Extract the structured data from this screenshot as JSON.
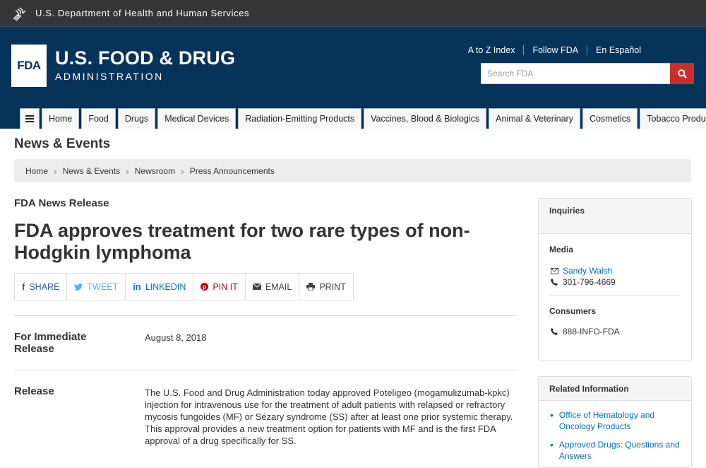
{
  "hhs_bar": {
    "text": "U.S. Department of Health and Human Services",
    "icon": "hhs-eagle-icon"
  },
  "header": {
    "logo_mark": "FDA",
    "logo_title": "U.S. FOOD & DRUG",
    "logo_subtitle": "ADMINISTRATION",
    "top_links": [
      "A to Z Index",
      "Follow FDA",
      "En Español"
    ],
    "search": {
      "placeholder": "Search FDA",
      "icon": "search-icon"
    },
    "colors": {
      "bg": "#06335a",
      "search_button": "#c9302c"
    }
  },
  "nav": {
    "menu_icon": "hamburger-menu-icon",
    "tabs": [
      "Home",
      "Food",
      "Drugs",
      "Medical Devices",
      "Radiation-Emitting Products",
      "Vaccines, Blood & Biologics",
      "Animal & Veterinary",
      "Cosmetics",
      "Tobacco Products"
    ]
  },
  "section_title": "News & Events",
  "breadcrumb": [
    "Home",
    "News & Events",
    "Newsroom",
    "Press Announcements"
  ],
  "article": {
    "kicker": "FDA News Release",
    "headline": "FDA approves treatment for two rare types of non-Hodgkin lymphoma",
    "share": {
      "share": "SHARE",
      "tweet": "TWEET",
      "linkedin": "LINKEDIN",
      "pinit": "PIN IT",
      "email": "EMAIL",
      "print": "PRINT"
    },
    "immediate_label": "For Immediate Release",
    "date": "August 8, 2018",
    "release_label": "Release",
    "release_text": "The U.S. Food and Drug Administration today approved Poteligeo (mogamulizumab-kpkc) injection for intravenous use for the treatment of adult patients with relapsed or refractory mycosis fungoides (MF) or Sézary syndrome (SS) after at least one prior systemic therapy. This approval provides a new treatment option for patients with MF and is the first FDA approval of a drug specifically for SS."
  },
  "sidebar": {
    "inquiries": {
      "title": "Inquiries",
      "media_label": "Media",
      "media_contact": "Sandy Walsh",
      "media_phone": "301-796-4669",
      "consumers_label": "Consumers",
      "consumers_phone": "888-INFO-FDA"
    },
    "related": {
      "title": "Related Information",
      "items": [
        "Office of Hematology and Oncology Products",
        "Approved Drugs: Questions and Answers"
      ]
    },
    "link_color": "#0071bc"
  }
}
